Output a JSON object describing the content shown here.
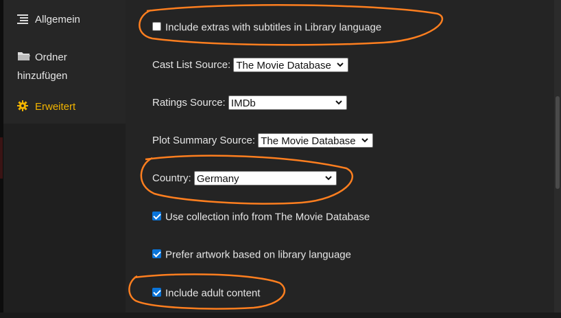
{
  "sidebar": {
    "items": [
      {
        "label": "Allgemein",
        "icon": "list-icon"
      },
      {
        "label": "Ordner",
        "label2": "hinzufügen",
        "icon": "folder-icon"
      },
      {
        "label": "Erweitert",
        "icon": "gear-icon",
        "active": true
      }
    ]
  },
  "settings": {
    "extras_subtitles": {
      "label": "Include extras with subtitles in Library language",
      "checked": false
    },
    "cast_source": {
      "label": "Cast List Source:",
      "value": "The Movie Database"
    },
    "ratings_source": {
      "label": "Ratings Source:",
      "value": "IMDb"
    },
    "plot_source": {
      "label": "Plot Summary Source:",
      "value": "The Movie Database"
    },
    "country": {
      "label": "Country:",
      "value": "Germany"
    },
    "collection_info": {
      "label": "Use collection info from The Movie Database",
      "checked": true
    },
    "prefer_artwork": {
      "label": "Prefer artwork based on library language",
      "checked": true
    },
    "adult_content": {
      "label": "Include adult content",
      "checked": true
    }
  },
  "colors": {
    "accent": "#f2b400",
    "annotation": "#ff7f1f",
    "checkbox": "#0a74d9"
  }
}
